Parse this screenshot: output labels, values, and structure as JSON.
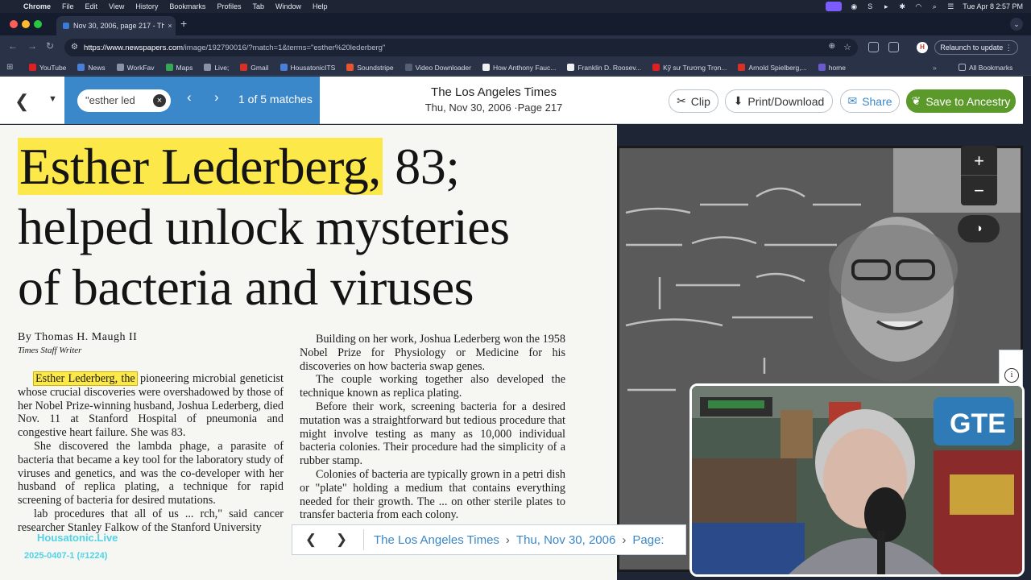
{
  "menubar": {
    "app": "Chrome",
    "items": [
      "File",
      "Edit",
      "View",
      "History",
      "Bookmarks",
      "Profiles",
      "Tab",
      "Window",
      "Help"
    ],
    "datetime": "Tue Apr 8  2:57 PM"
  },
  "tab": {
    "title": "Nov 30, 2006, page 217 - Th",
    "close": "×",
    "new_tab": "+"
  },
  "toolbar": {
    "url_host": "https://www.newspapers.com",
    "url_path": "/image/192790016/?match=1&terms=\"esther%20lederberg\"",
    "relaunch": "Relaunch to update",
    "profile_initial": "H"
  },
  "bookmarks": {
    "items": [
      {
        "label": "YouTube",
        "color": "#e02020"
      },
      {
        "label": "News",
        "color": "#4a7fd8"
      },
      {
        "label": "WorkFav",
        "color": "#8a93a6"
      },
      {
        "label": "Maps",
        "color": "#34a853"
      },
      {
        "label": "Live;",
        "color": "#8a93a6"
      },
      {
        "label": "Gmail",
        "color": "#d93025"
      },
      {
        "label": "HousatonicITS",
        "color": "#4a7fd8"
      },
      {
        "label": "Soundstripe",
        "color": "#e8542e"
      },
      {
        "label": "Video Downloader",
        "color": "#555e73"
      },
      {
        "label": "How Anthony Fauc...",
        "color": "#f0f0f0"
      },
      {
        "label": "Franklin D. Roosev...",
        "color": "#f0f0f0"
      },
      {
        "label": "Kỹ sư Trương Trọn...",
        "color": "#e02020"
      },
      {
        "label": "Arnold Spielberg,...",
        "color": "#d93025"
      },
      {
        "label": "home",
        "color": "#6a5acd"
      }
    ],
    "more": "»",
    "all": "All Bookmarks"
  },
  "viewer": {
    "search_text": "\"esther led",
    "match_count": "1 of 5 matches",
    "publication": "The Los Angeles Times",
    "date_page": "Thu, Nov 30, 2006 ·Page 217",
    "clip": "Clip",
    "print": "Print/Download",
    "share": "Share",
    "ancestry": "Save to Ancestry"
  },
  "article": {
    "headline_mark": "Esther Lederberg,",
    "headline_rest": " 83;",
    "headline_line2": "helped unlock mysteries",
    "headline_line3": "of bacteria and viruses",
    "byline": "By Thomas H. Maugh II",
    "staff": "Times Staff Writer",
    "col1_mark": "Esther Lederberg, the",
    "col1_p1": " pioneering microbial geneticist whose crucial discoveries were overshadowed by those of her Nobel Prize-winning husband, Joshua Lederberg, died Nov. 11 at Stanford Hospital of pneumonia and congestive heart failure. She was 83.",
    "col1_p2": "She discovered the lambda phage, a parasite of bacteria that became a key tool for the laboratory study of viruses and genetics, and was the co-developer with her husband of replica plating, a technique for rapid screening of bacteria for desired mutations.",
    "col1_p3": "lab procedures that all of us ... rch,\" said cancer researcher Stanley Falkow of the Stanford University",
    "col2_p1": "Building on her work, Joshua Lederberg won the 1958 Nobel Prize for Physiology or Medicine for his discoveries on how bacteria swap genes.",
    "col2_p2": "The couple working together also developed the technique known as replica plating.",
    "col2_p3": "Before their work, screening bacteria for a desired mutation was a straightforward but tedious procedure that might involve testing as many as 10,000 individual bacteria colonies. Their procedure had the simplicity of a rubber stamp.",
    "col2_p4": "Colonies of bacteria are typically grown in a petri dish or \"plate\" holding a medium that contains everything needed for their growth. The ... on other sterile plates to transfer bacteria from each colony."
  },
  "photo_controls": {
    "zoom_in": "+",
    "zoom_out": "−",
    "contrast": "◑",
    "info": "i"
  },
  "pagenav": {
    "prev": "❮",
    "next": "❯",
    "publication": "The Los Angeles Times",
    "date": "Thu, Nov 30, 2006",
    "page_label": "Page:",
    "sep": "›"
  },
  "watermark": {
    "line1": "Housatonic.Live",
    "line2": "2025-0407-1 (#1224)"
  },
  "colors": {
    "accent_blue": "#3a87c9",
    "ancestry_green": "#5b9a2a",
    "highlight": "#fde84a"
  }
}
